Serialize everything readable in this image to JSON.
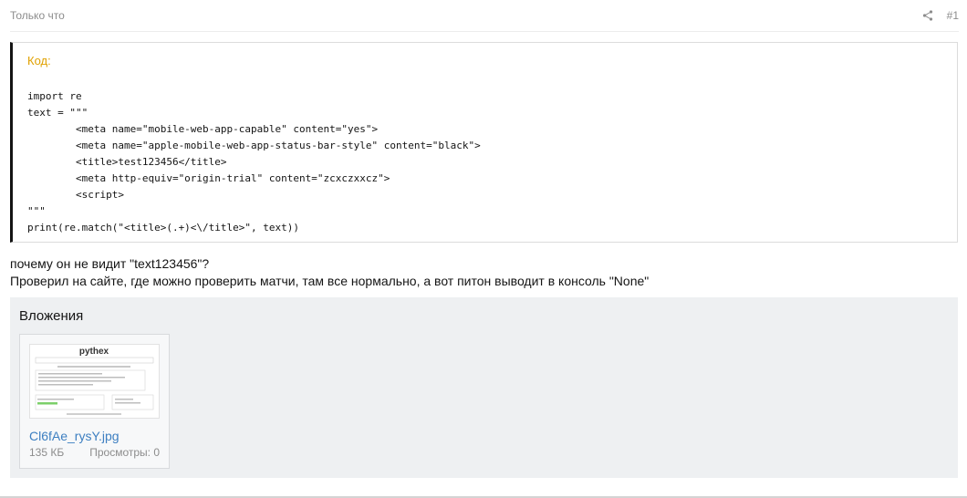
{
  "post": {
    "timestamp": "Только что",
    "number": "#1",
    "share_icon": "share-icon"
  },
  "code": {
    "title": "Код:",
    "text": "import re\ntext = \"\"\"\n        <meta name=\"mobile-web-app-capable\" content=\"yes\">\n        <meta name=\"apple-mobile-web-app-status-bar-style\" content=\"black\">\n        <title>test123456</title>\n        <meta http-equiv=\"origin-trial\" content=\"zcxczxxcz\">\n        <script>\n\"\"\"\nprint(re.match(\"<title>(.+)<\\/title>\", text))"
  },
  "message": {
    "line1": "почему он не видит \"text123456\"?",
    "line2": "Проверил на сайте, где можно проверить матчи, там все нормально, а вот питон выводит в консоль \"None\""
  },
  "attachments": {
    "title": "Вложения",
    "items": [
      {
        "filename": "Cl6fAe_rysY.jpg",
        "size": "135 КБ",
        "views": "Просмотры: 0",
        "thumbnail_heading": "pythex"
      }
    ]
  },
  "colors": {
    "code_title": "#e0a100",
    "link": "#3d7fc1",
    "muted": "#8c8c8c",
    "attachments_bg": "#eef0f2"
  }
}
